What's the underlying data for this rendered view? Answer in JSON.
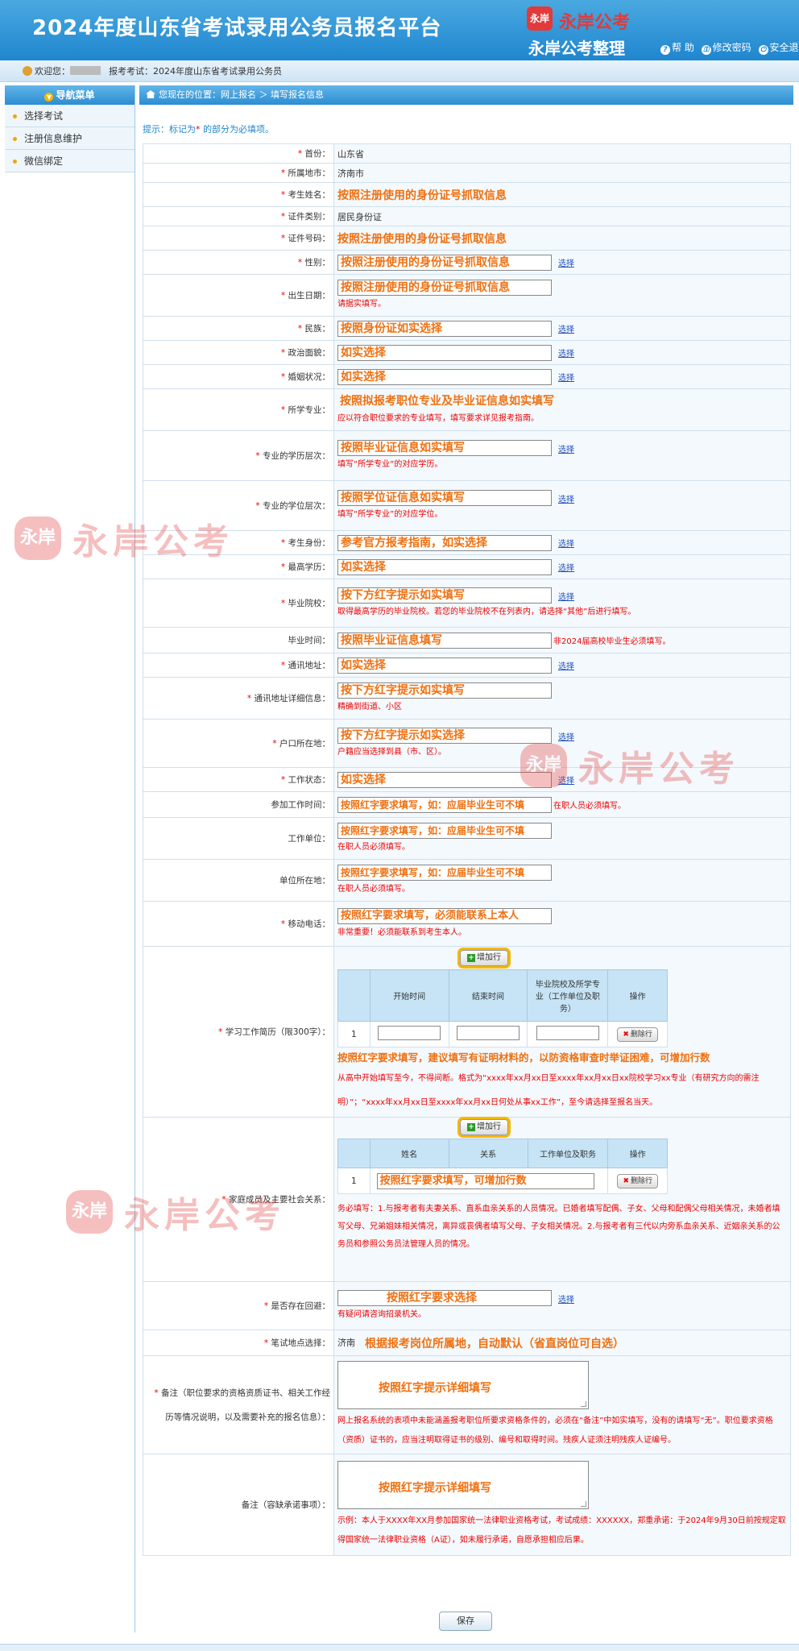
{
  "header": {
    "title": "2024年度山东省考试录用公务员报名平台",
    "brand_badge": "永岸",
    "brand_name": "永岸公考",
    "brand_sub": "永岸公考整理",
    "links": {
      "help": "帮 助",
      "change_password": "修改密码",
      "logout": "安全退"
    }
  },
  "welcome": {
    "welcome_label": "欢迎您：",
    "exam_label": "报考考试：2024年度山东省考试录用公务员"
  },
  "sidebar": {
    "title": "导航菜单",
    "items": [
      "选择考试",
      "注册信息维护",
      "微信绑定"
    ]
  },
  "breadcrumb": "您现在的位置：网上报名 ＞ 填写报名信息",
  "hint": {
    "pre": "提示：标记为",
    "star": "*",
    "post": " 的部分为必填项。"
  },
  "select_label": "选择",
  "form": {
    "province": {
      "label": "首份：",
      "value": "山东省"
    },
    "city": {
      "label": "所属地市：",
      "value": "济南市"
    },
    "name": {
      "label": "考生姓名：",
      "value": "按照注册使用的身份证号抓取信息"
    },
    "id_type": {
      "label": "证件类别：",
      "value": "居民身份证"
    },
    "id_number": {
      "label": "证件号码：",
      "value": "按照注册使用的身份证号抓取信息"
    },
    "gender": {
      "label": "性别：",
      "value": "按照注册使用的身份证号抓取信息"
    },
    "birth": {
      "label": "出生日期：",
      "value": "按照注册使用的身份证号抓取信息",
      "note": "请据实填写。"
    },
    "ethnicity": {
      "label": "民族：",
      "value": "按照身份证如实选择"
    },
    "politics": {
      "label": "政治面貌：",
      "value": "如实选择"
    },
    "marital": {
      "label": "婚姻状况：",
      "value": "如实选择"
    },
    "major": {
      "label": "所学专业：",
      "value": "按照拟报考职位专业及毕业证信息如实填写",
      "note": "应以符合职位要求的专业填写，填写要求详见报考指南。"
    },
    "edu_level": {
      "label": "专业的学历层次：",
      "value": "按照毕业证信息如实填写",
      "note": "填写“所学专业”的对应学历。"
    },
    "degree_level": {
      "label": "专业的学位层次：",
      "value": "按照学位证信息如实填写",
      "note": "填写“所学专业”的对应学位。"
    },
    "candidate_status": {
      "label": "考生身份：",
      "value": "参考官方报考指南，如实选择"
    },
    "highest_edu": {
      "label": "最高学历：",
      "value": "如实选择"
    },
    "school": {
      "label": "毕业院校：",
      "value": "按下方红字提示如实填写",
      "note": "取得最高学历的毕业院校。若您的毕业院校不在列表内，请选择“其他”后进行填写。"
    },
    "grad_time": {
      "label": "毕业时间：",
      "value": "按照毕业证信息填写",
      "note": "非2024届高校毕业生必须填写。"
    },
    "address": {
      "label": "通讯地址：",
      "value": "如实选择"
    },
    "address_detail": {
      "label": "通讯地址详细信息：",
      "value": "按下方红字提示如实填写",
      "note": "精确到街道、小区"
    },
    "hukou": {
      "label": "户口所在地：",
      "value": "按下方红字提示如实选择",
      "note": "户籍应当选择到县（市、区）。"
    },
    "work_status": {
      "label": "工作状态：",
      "value": "如实选择"
    },
    "work_start": {
      "label": "参加工作时间：",
      "value": "按照红字要求填写，如：应届毕业生可不填",
      "note": "在职人员必须填写。"
    },
    "employer": {
      "label": "工作单位：",
      "value": "按照红字要求填写，如：应届毕业生可不填",
      "note": "在职人员必须填写。"
    },
    "employer_location": {
      "label": "单位所在地：",
      "value": "按照红字要求填写，如：应届毕业生可不填",
      "note": "在职人员必须填写。"
    },
    "mobile": {
      "label": "移动电话：",
      "value": "按照红字要求填写，必须能联系上本人",
      "note": "非常重要！必须能联系到考生本人。"
    },
    "resume": {
      "label": "学习工作简历（限300字）：",
      "add": "增加行",
      "headers": [
        "",
        "开始时间",
        "结束时间",
        "毕业院校及所学专业（工作单位及职务）",
        "操作"
      ],
      "row_no": "1",
      "delete": "删除行",
      "instruction": "按照红字要求填写，建议填写有证明材料的，以防资格审查时举证困难，可增加行数",
      "note": "从高中开始填写至今，不得间断。格式为“xxxx年xx月xx日至xxxx年xx月xx日xx院校学习xx专业（有研究方向的需注明）”；“xxxx年xx月xx日至xxxx年xx月xx日何处从事xx工作”，至今请选择至报名当天。"
    },
    "family": {
      "label": "家庭成员及主要社会关系：",
      "add": "增加行",
      "headers": [
        "",
        "姓名",
        "关系",
        "工作单位及职务",
        "操作"
      ],
      "row_no": "1",
      "delete": "删除行",
      "instruction": "按照红字要求填写，可增加行数",
      "note": "务必填写：1.与报考者有夫妻关系、直系血亲关系的人员情况。已婚者填写配偶、子女、父母和配偶父母相关情况，未婚者填写父母、兄弟姐妹相关情况，离异或丧偶者填写父母、子女相关情况。2.与报考者有三代以内旁系血亲关系、近姻亲关系的公务员和参照公务员法管理人员的情况。"
    },
    "rejected": {
      "label": "是否存在回避：",
      "value": "按照红字要求选择",
      "note": "有疑问请咨询招录机关。"
    },
    "test_site": {
      "label": "笔试地点选择：",
      "value": "济南",
      "instruction": "根据报考岗位所属地，自动默认（省直岗位可自选）"
    },
    "remark": {
      "label": "备注（职位要求的资格资质证书、相关工作经历等情况说明，以及需要补充的报名信息）：",
      "value": "按照红字提示详细填写",
      "note": "网上报名系统的表项中未能涵盖报考职位所要求资格条件的，必须在“备注”中如实填写，没有的请填写“无”。职位要求资格（资质）证书的，应当注明取得证书的级别、编号和取得时间。残疾人证须注明残疾人证编号。"
    },
    "commitment": {
      "label": "备注（容缺承诺事项）：",
      "value": "按照红字提示详细填写",
      "note": "示例：本人于XXXX年XX月参加国家统一法律职业资格考试，考试成绩：XXXXXX，郑重承诺：于2024年9月30日前按规定取得国家统一法律职业资格（A证），如未履行承诺，自愿承担相应后果。"
    }
  },
  "save": "保存",
  "watermark": {
    "badge": "永岸",
    "text": "永岸公考"
  }
}
